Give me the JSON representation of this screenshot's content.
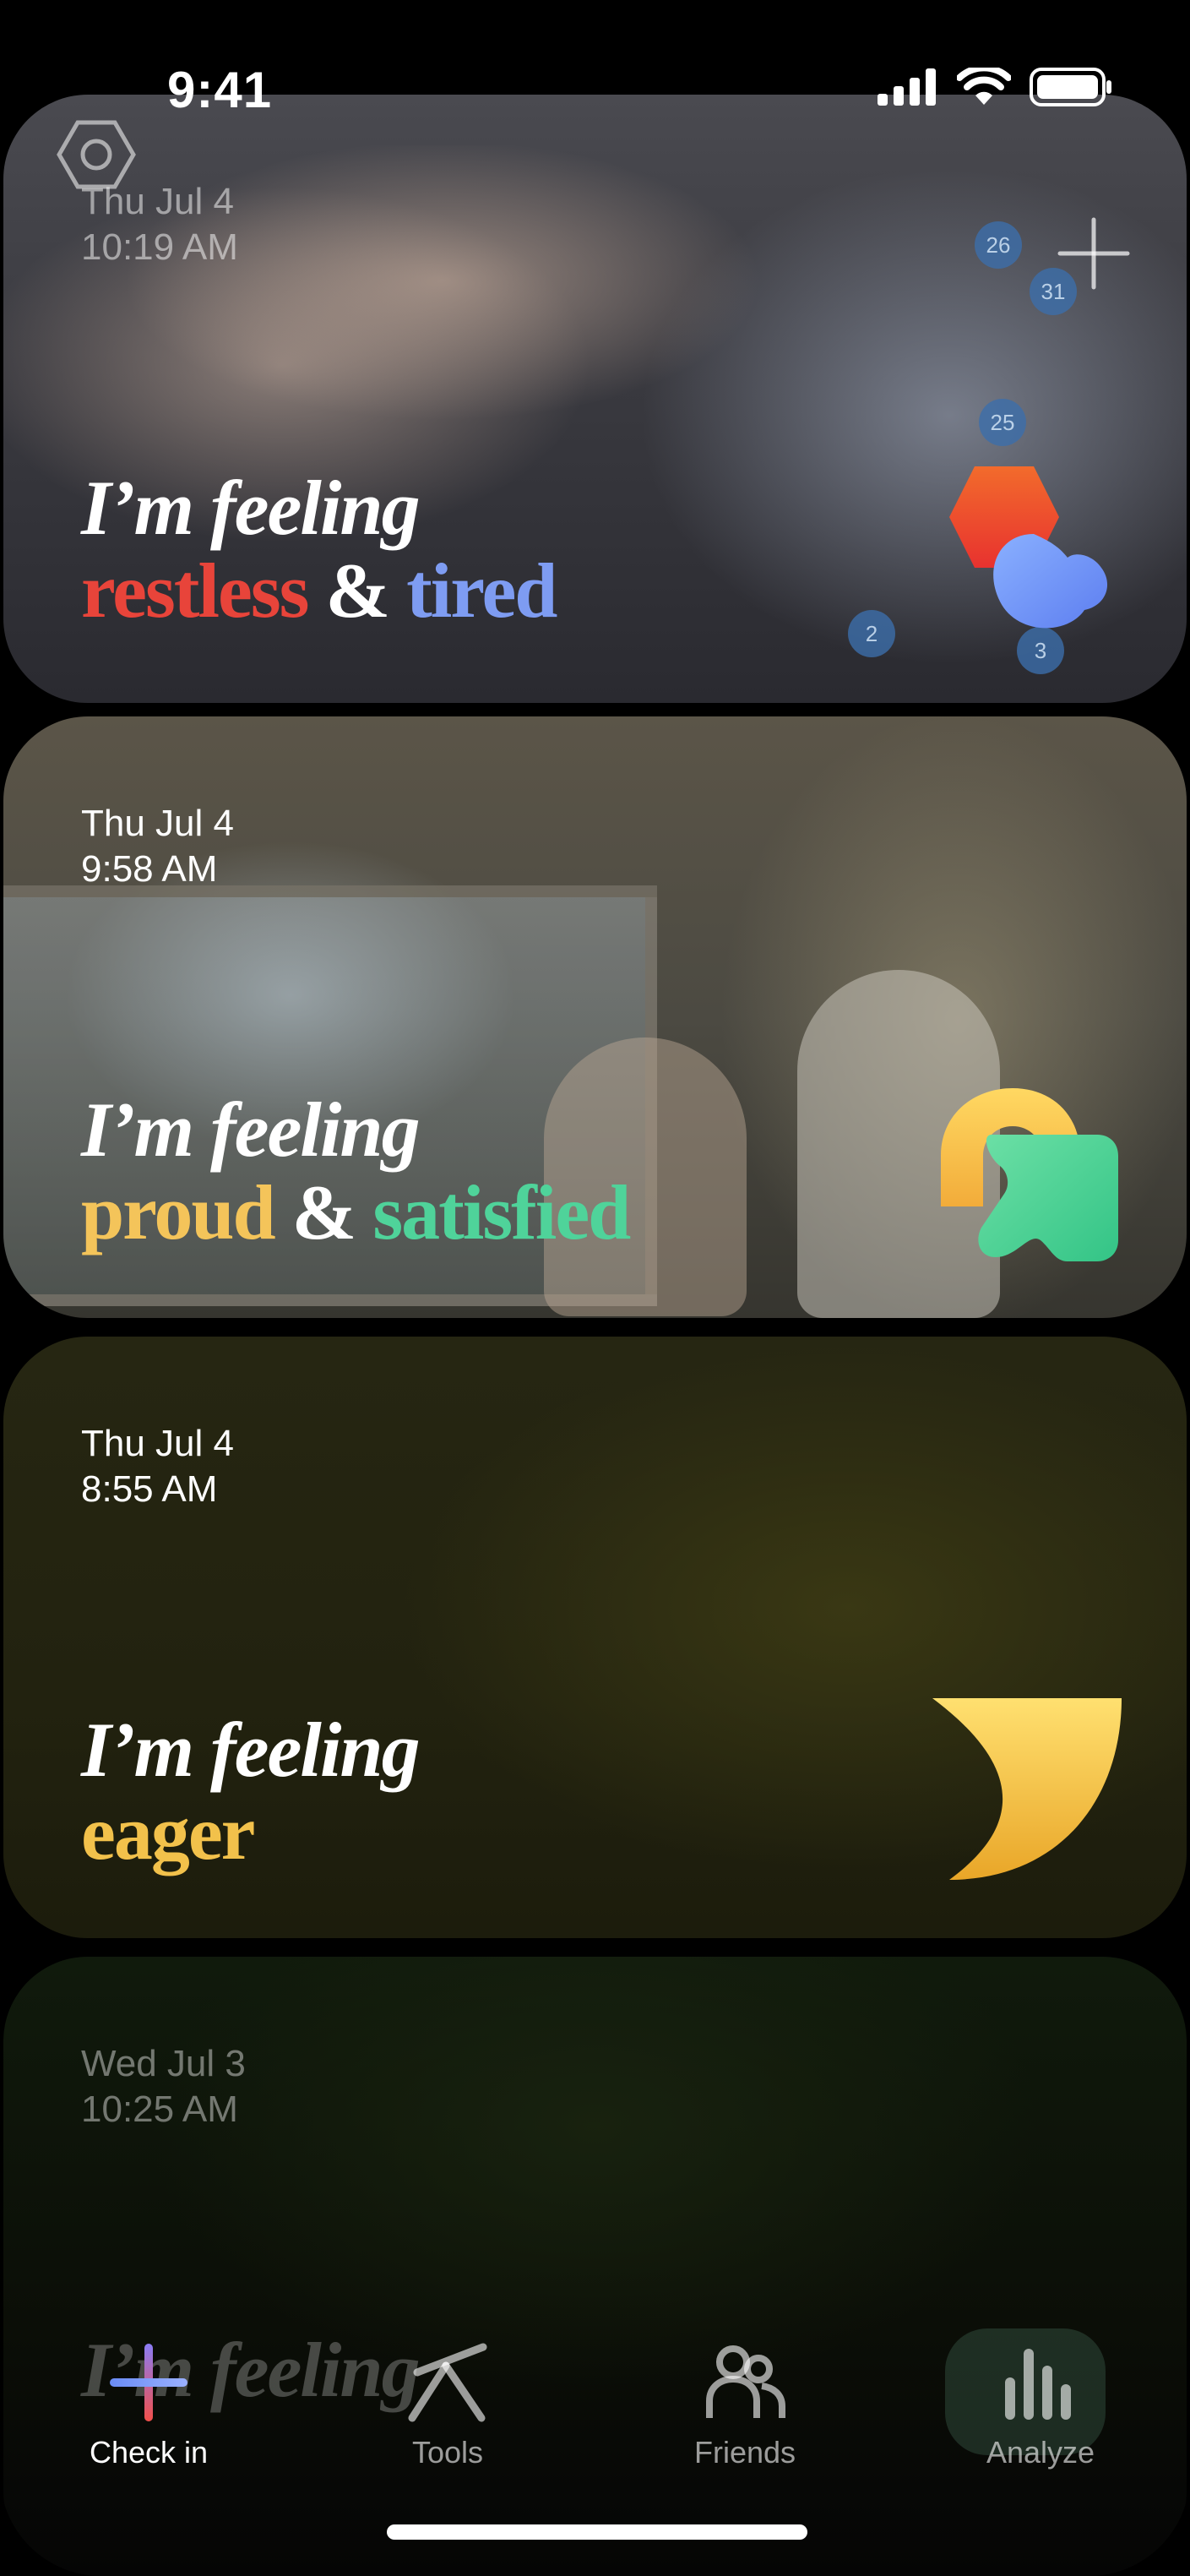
{
  "status_bar": {
    "time": "9:41"
  },
  "entries": [
    {
      "date": "Thu Jul 4",
      "time": "10:19 AM",
      "lead": "I’m feeling",
      "emotion_1": "restless",
      "amp": "&",
      "emotion_2": "tired",
      "color_1": "#e8443a",
      "color_2": "#7e9cf2",
      "icon": "hexagon-moon-icon"
    },
    {
      "date": "Thu Jul 4",
      "time": "9:58 AM",
      "lead": "I’m feeling",
      "emotion_1": "proud",
      "amp": "&",
      "emotion_2": "satisfied",
      "color_1": "#f4c45a",
      "color_2": "#4fd39a",
      "icon": "arch-blob-icon"
    },
    {
      "date": "Thu Jul 4",
      "time": "8:55 AM",
      "lead": "I’m feeling",
      "emotion_1": "eager",
      "color_1": "#f2c14b",
      "icon": "crescent-icon"
    },
    {
      "date": "Wed Jul 3",
      "time": "10:25 AM",
      "lead": "I’m feeling",
      "icon": "emotion-icon"
    }
  ],
  "map_markers": [
    "26",
    "31",
    "25",
    "2",
    "3"
  ],
  "tabs": [
    {
      "label": "Check in",
      "icon": "plus-icon",
      "active": true
    },
    {
      "label": "Tools",
      "icon": "tools-icon",
      "active": false
    },
    {
      "label": "Friends",
      "icon": "friends-icon",
      "active": false
    },
    {
      "label": "Analyze",
      "icon": "chart-icon",
      "active": false
    }
  ]
}
